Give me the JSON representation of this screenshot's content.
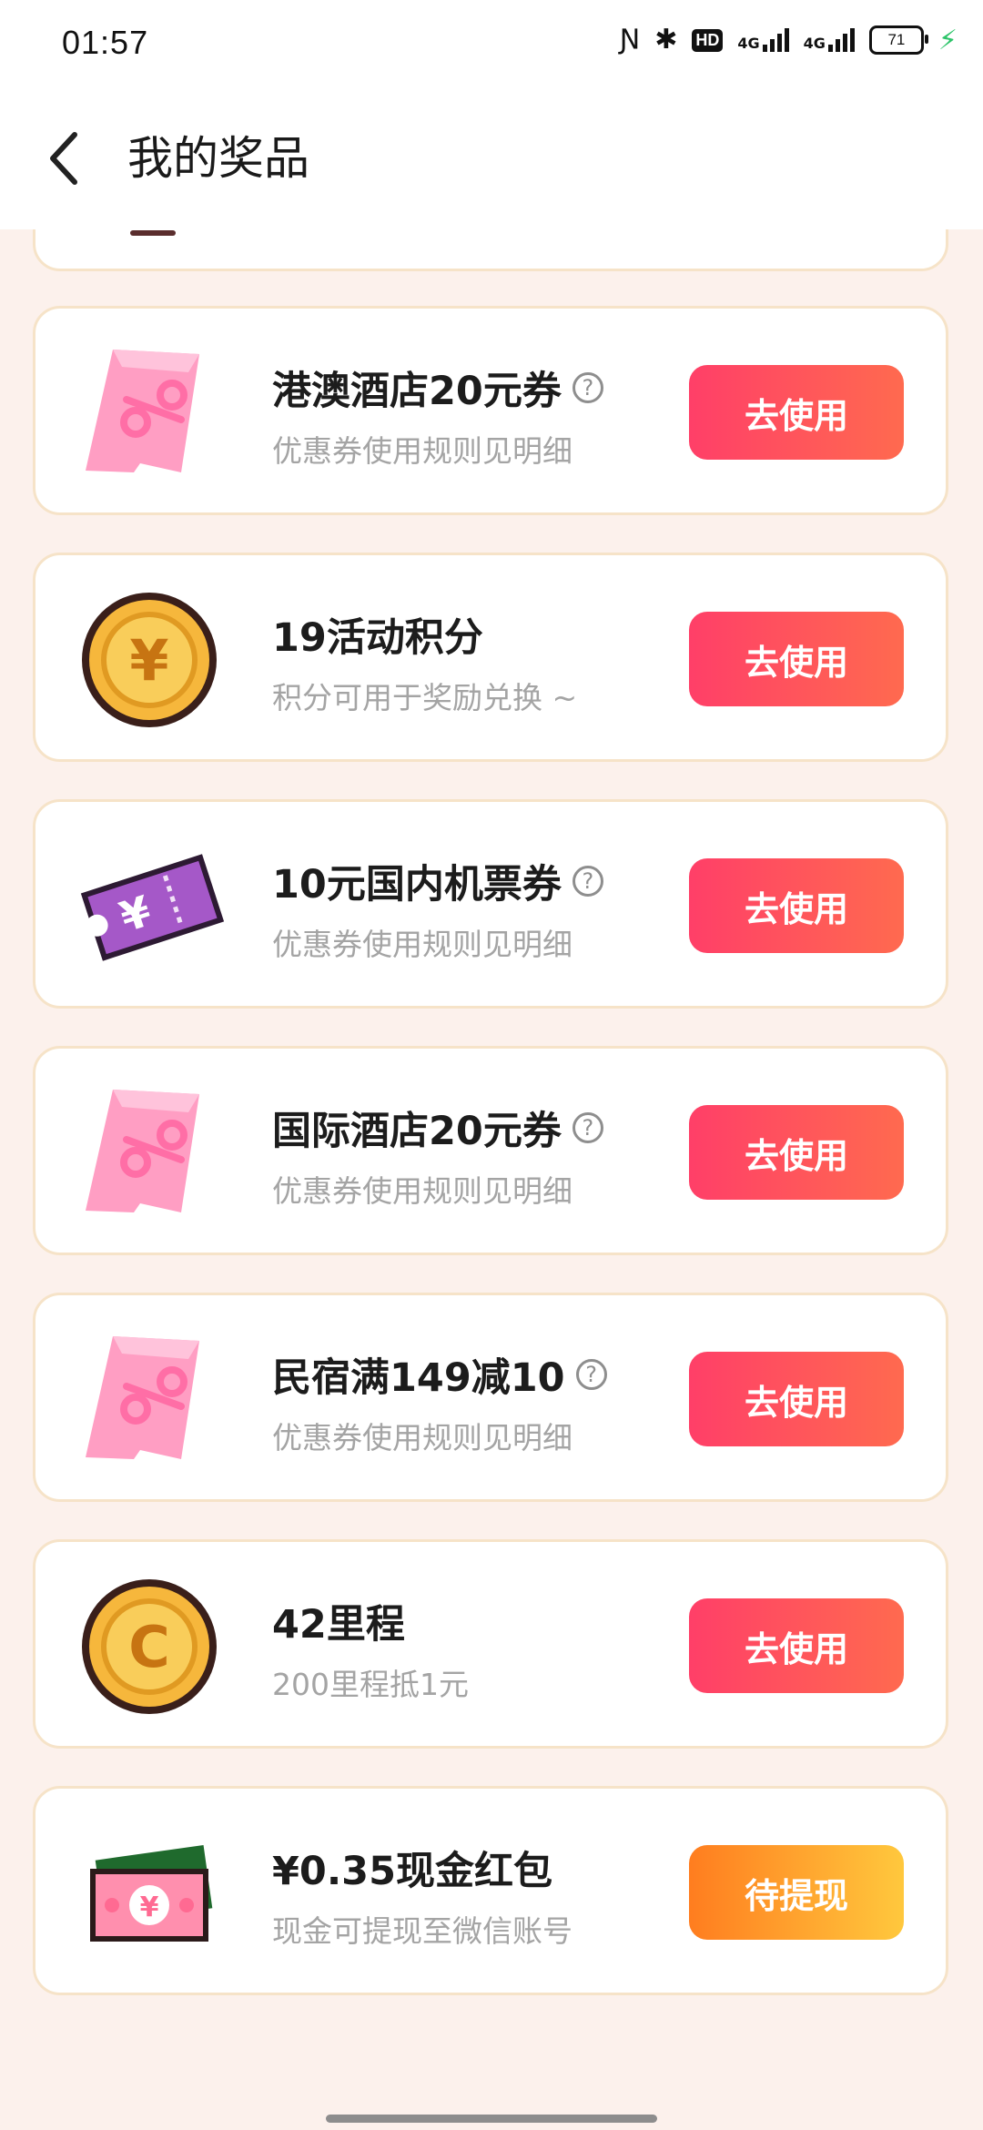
{
  "status_bar": {
    "time": "01:57",
    "hd": "HD",
    "net1": "4G",
    "net2": "4G",
    "battery": "71"
  },
  "header": {
    "title": "我的奖品"
  },
  "prizes": [
    {
      "name": "港澳酒店20元券",
      "desc": "优惠券使用规则见明细",
      "button": "去使用",
      "icon": "discount-ticket-icon",
      "help": true
    },
    {
      "name": "19活动积分",
      "desc": "积分可用于奖励兑换 ~",
      "button": "去使用",
      "icon": "yuan-coin-icon",
      "help": false
    },
    {
      "name": "10元国内机票券",
      "desc": "优惠券使用规则见明细",
      "button": "去使用",
      "icon": "flight-ticket-icon",
      "help": true
    },
    {
      "name": "国际酒店20元券",
      "desc": "优惠券使用规则见明细",
      "button": "去使用",
      "icon": "discount-ticket-icon",
      "help": true
    },
    {
      "name": "民宿满149减10",
      "desc": "优惠券使用规则见明细",
      "button": "去使用",
      "icon": "discount-ticket-icon",
      "help": true
    },
    {
      "name": "42里程",
      "desc": "200里程抵1元",
      "button": "去使用",
      "icon": "mileage-coin-icon",
      "help": false
    },
    {
      "name": "¥0.35现金红包",
      "desc": "现金可提现至微信账号",
      "button": "待提现",
      "icon": "cash-bill-icon",
      "help": false
    }
  ],
  "colors": {
    "page_bg": "#fcf1ec",
    "use_button": "#ff4d63",
    "cash_button": "#ffa52e",
    "card_border": "#f6e3c8"
  }
}
